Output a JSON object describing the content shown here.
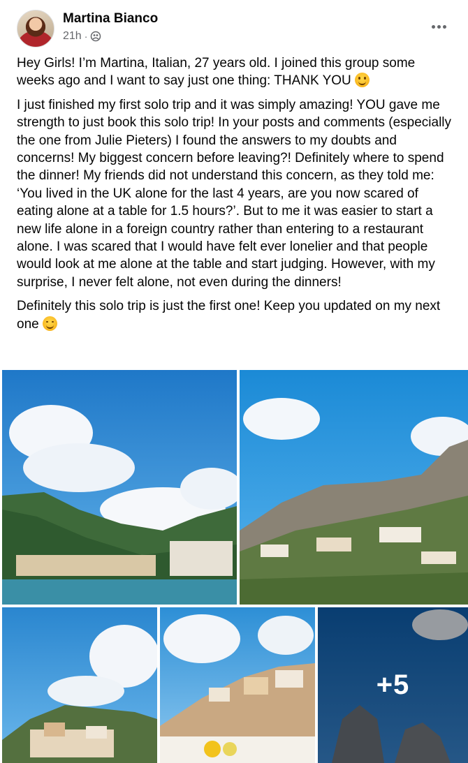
{
  "post": {
    "author": "Martina Bianco",
    "time": "21h",
    "separator": "·",
    "audience_icon": "group-globe-icon",
    "more_icon": "more-options-icon",
    "paragraphs": [
      "Hey Girls! I’m Martina, Italian, 27 years old. I joined this group some weeks ago and I want to say just one thing: THANK YOU",
      "I just finished my first solo trip and it was simply amazing! YOU gave me strength to just book this solo trip! In your posts and comments (especially the one from Julie Pieters) I found the answers to my doubts and concerns! My biggest concern before leaving?! Definitely where to spend the dinner! My friends did not understand this concern, as they told me: ‘You lived in the UK alone for the last 4 years, are you now scared of eating alone at a table for 1.5 hours?’. But to me it was easier to start a new life alone in a foreign country rather than entering to a restaurant alone. I was scared that I would have felt ever lonelier and that people would look at me alone at the table and start judging. However, with my surprise, I never felt alone, not even during the dinners!",
      "Definitely this solo trip is just the first one! Keep you updated on my next one"
    ],
    "emojis": [
      "smiling-face-emoji",
      "winking-face-emoji"
    ],
    "photos": [
      "amalfi-coast-photo",
      "hillside-town-photo",
      "positano-photo",
      "cliff-village-photo",
      "faraglioni-rocks-photo"
    ],
    "more_photos_label": "+5"
  }
}
